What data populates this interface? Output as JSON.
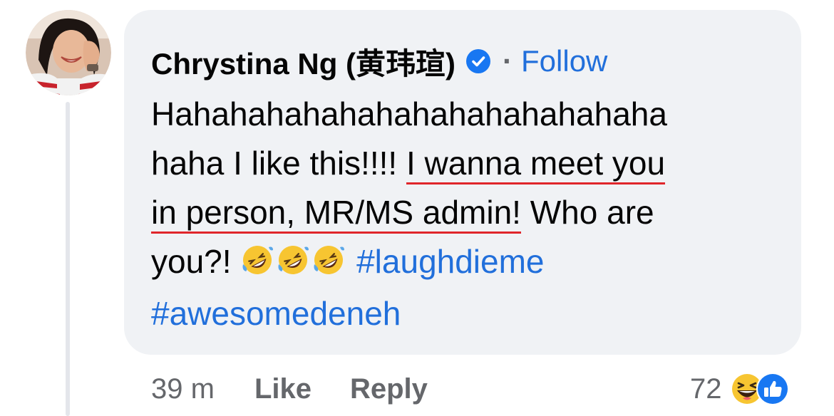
{
  "comment": {
    "author": "Chrystina Ng (黄玮瑄)",
    "verified_icon": "verified-badge-icon",
    "separator": "·",
    "follow_label": "Follow",
    "text_lines": [
      "Hahahahahahahahahahahahahaha",
      "haha I like this!!!! ",
      "I wanna meet you",
      "in person, MR/MS admin!",
      " Who are",
      "you?! "
    ],
    "emojis": [
      "rolling-on-floor-laughing-icon",
      "rolling-on-floor-laughing-icon",
      "rolling-on-floor-laughing-icon"
    ],
    "hashtags": [
      "#laughdieme",
      "#awesomedeneh"
    ]
  },
  "actions": {
    "time": "39 m",
    "like_label": "Like",
    "reply_label": "Reply"
  },
  "reactions": {
    "count": "72",
    "icons": [
      "haha-reaction-icon",
      "like-reaction-icon"
    ]
  },
  "colors": {
    "link_blue": "#216fdb",
    "underline_red": "#e0262b",
    "bubble_bg": "#f0f2f5",
    "muted_text": "#65676b"
  }
}
